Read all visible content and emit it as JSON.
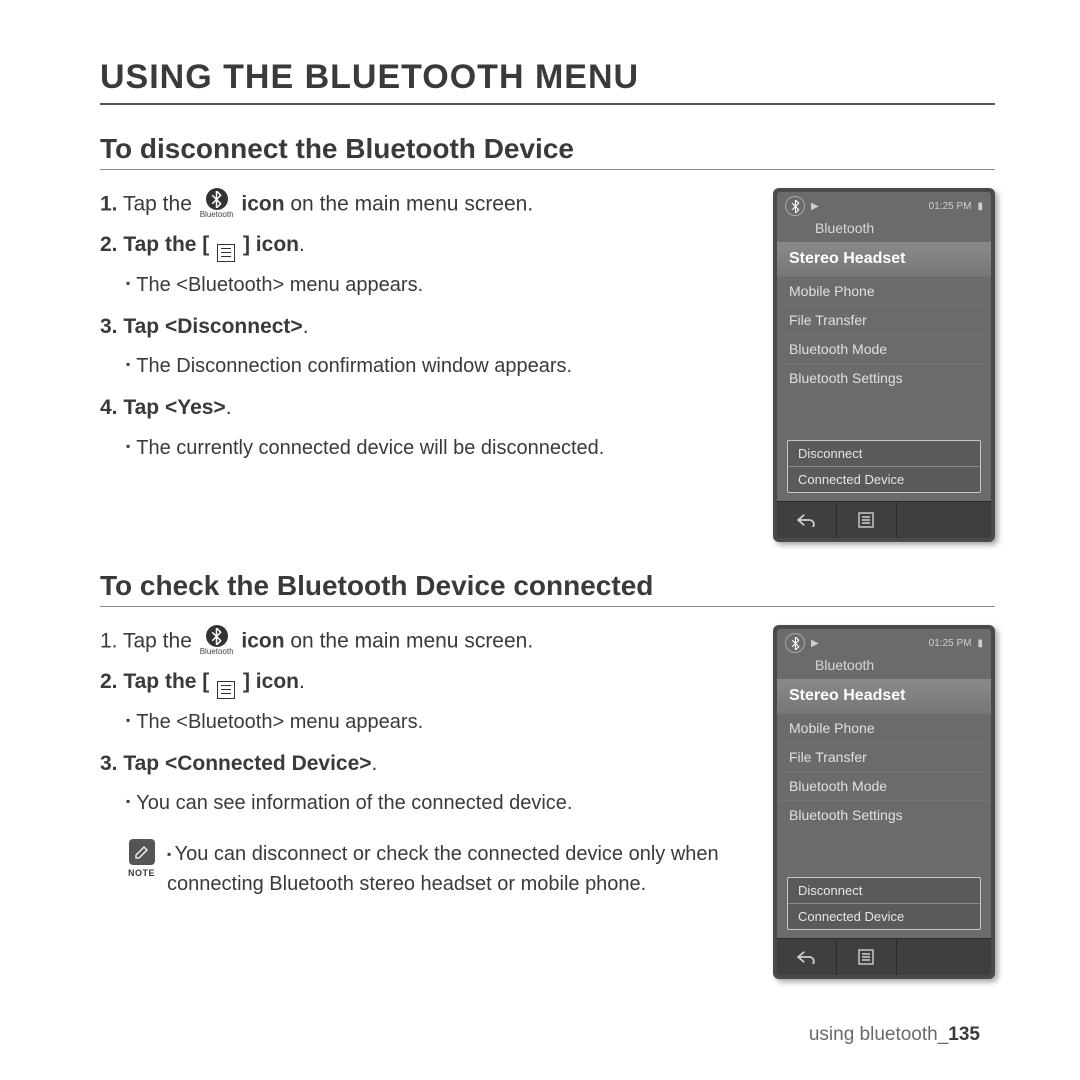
{
  "page_title": "USING THE BLUETOOTH MENU",
  "bt_icon_label": "Bluetooth",
  "section1": {
    "title": "To disconnect the Bluetooth Device",
    "step1_a": "1.",
    "step1_b": "Tap the",
    "step1_c": "icon",
    "step1_d": " on the main menu screen.",
    "step2": "2. Tap the [",
    "step2_b": "] icon",
    "step2_c": ".",
    "sub2": "The <Bluetooth> menu appears.",
    "step3": "3. Tap <Disconnect>",
    "step3_c": ".",
    "sub3": "The Disconnection confirmation window appears.",
    "step4": "4. Tap <Yes>",
    "step4_c": ".",
    "sub4": "The currently connected device will be disconnected."
  },
  "section2": {
    "title": "To check the Bluetooth Device connected",
    "step1_a": "1.",
    "step1_b": "Tap the",
    "step1_c": "icon",
    "step1_d": " on the main menu screen.",
    "step2": "2. Tap the [",
    "step2_b": "] icon",
    "step2_c": ".",
    "sub2": "The <Bluetooth> menu appears.",
    "step3": "3. Tap <Connected Device>",
    "step3_c": ".",
    "sub3": "You can see information of the connected device."
  },
  "note": {
    "label": "NOTE",
    "text": "You can disconnect or check the connected device only when connecting Bluetooth stereo headset or mobile phone."
  },
  "device": {
    "time": "01:25 PM",
    "title": "Bluetooth",
    "highlight": "Stereo Headset",
    "items": [
      "Mobile Phone",
      "File Transfer",
      "Bluetooth Mode",
      "Bluetooth Settings"
    ],
    "popup": [
      "Disconnect",
      "Connected Device"
    ]
  },
  "footer": {
    "label": "using bluetooth_",
    "page": "135"
  }
}
